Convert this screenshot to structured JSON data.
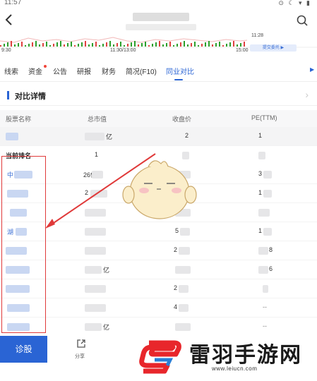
{
  "status_bar": {
    "time": "11:57",
    "icons": "⊙ ☾ ▾ ▮"
  },
  "mini_chart": {
    "left_time": "9:30",
    "mid_time": "11:30/13:00",
    "right_time": "15:00",
    "right_top_time": "11:28",
    "button_label": "提交委托 ▶"
  },
  "tabs": [
    {
      "label": "线索"
    },
    {
      "label": "资金"
    },
    {
      "label": "公告"
    },
    {
      "label": "研报"
    },
    {
      "label": "财务"
    },
    {
      "label": "简况(F10)"
    },
    {
      "label": "同业对比"
    }
  ],
  "section": {
    "title": "对比详情"
  },
  "table": {
    "columns": [
      "股票名称",
      "总市值",
      "收盘价",
      "PE(TTM)"
    ],
    "rows": [
      {
        "name": "",
        "cap": "亿",
        "price": "2",
        "pe": "1"
      },
      {
        "name": "当前排名",
        "cap": "1",
        "price": "",
        "pe": ""
      },
      {
        "name": "中",
        "cap": "26亿",
        "price": "",
        "pe": "3"
      },
      {
        "name": "",
        "cap": "2",
        "price": "",
        "pe": "1"
      },
      {
        "name": "",
        "cap": "",
        "price": "",
        "pe": ""
      },
      {
        "name": "湖",
        "cap": "",
        "price": "5",
        "pe": "1"
      },
      {
        "name": "",
        "cap": "",
        "price": "2",
        "pe": "8"
      },
      {
        "name": "",
        "cap": "亿",
        "price": "",
        "pe": "6"
      },
      {
        "name": "",
        "cap": "",
        "price": "2",
        "pe": ""
      },
      {
        "name": "",
        "cap": "",
        "price": "4",
        "pe": "--"
      },
      {
        "name": "",
        "cap": "亿",
        "price": "",
        "pe": "--"
      }
    ]
  },
  "bottom": {
    "diagnose_label": "诊股",
    "share_label": "分享"
  },
  "watermark": {
    "brand": "雷羽手游网",
    "url": "www.leiucn.com"
  },
  "colors": {
    "accent": "#2a64d4",
    "annotation_red": "#e03a3a",
    "chart_green": "#2ca02c",
    "chart_red": "#e04040"
  }
}
